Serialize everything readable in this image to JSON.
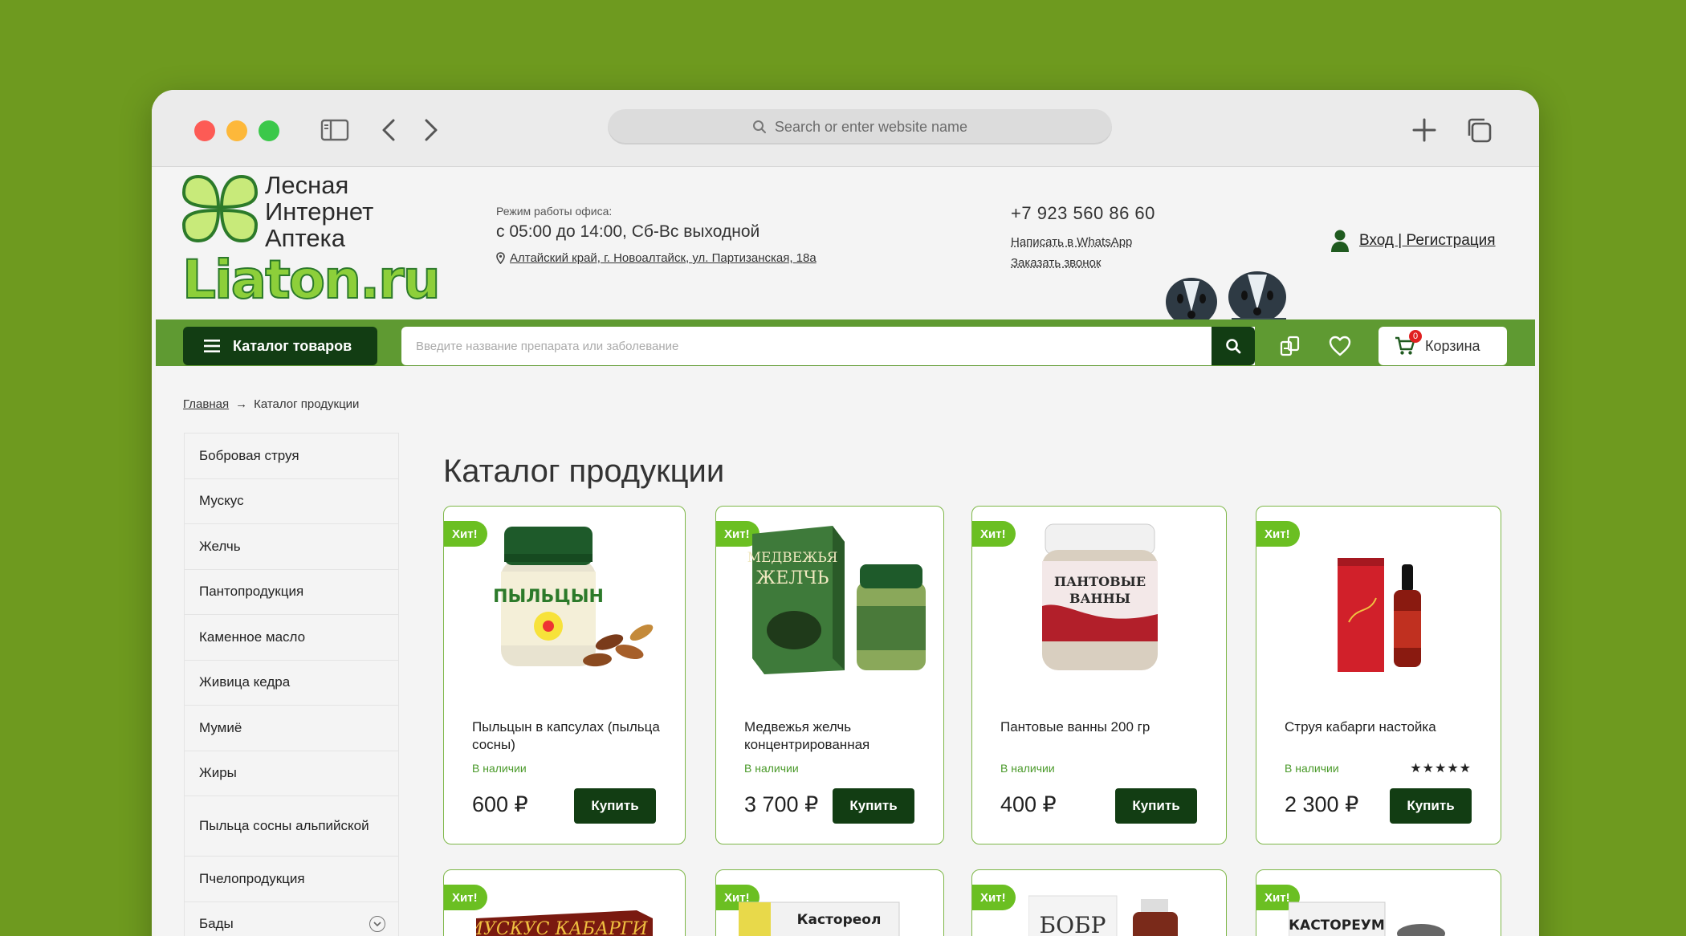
{
  "browser": {
    "url_placeholder": "Search or enter website name"
  },
  "logo": {
    "line1": "Лесная",
    "line2": "Интернет",
    "line3": "Аптека",
    "brand": "Liaton.ru"
  },
  "office": {
    "label": "Режим работы офиса:",
    "hours": "с 05:00 до 14:00, Сб-Вс выходной",
    "address": "Алтайский край, г. Новоалтайск, ул. Партизанская, 18а"
  },
  "contacts": {
    "phone": "+7 923 560 86 60",
    "whatsapp": "Написать в WhatsApp",
    "callback": "Заказать звонок"
  },
  "login": {
    "label": "Вход | Регистрация"
  },
  "nav": {
    "catalog_label": "Каталог товаров",
    "search_placeholder": "Введите название препарата или заболевание",
    "cart_label": "Корзина",
    "cart_count": "0"
  },
  "breadcrumb": {
    "home": "Главная",
    "sep": "→",
    "current": "Каталог продукции"
  },
  "sidemenu": [
    {
      "label": "Бобровая струя"
    },
    {
      "label": "Мускус"
    },
    {
      "label": "Желчь"
    },
    {
      "label": "Пантопродукция"
    },
    {
      "label": "Каменное масло"
    },
    {
      "label": "Живица кедра"
    },
    {
      "label": "Мумиё"
    },
    {
      "label": "Жиры"
    },
    {
      "label": "Пыльца сосны альпийской"
    },
    {
      "label": "Пчелопродукция"
    },
    {
      "label": "Бады"
    }
  ],
  "page_title": "Каталог продукции",
  "products": [
    {
      "badge": "Хит!",
      "name": "Пыльцын в капсулах (пыльца сосны)",
      "stock": "В наличии",
      "price": "600 ₽",
      "buy": "Купить"
    },
    {
      "badge": "Хит!",
      "name": "Медвежья желчь концентрированная",
      "stock": "В наличии",
      "price": "3 700 ₽",
      "buy": "Купить"
    },
    {
      "badge": "Хит!",
      "name": "Пантовые ванны 200 гр",
      "stock": "В наличии",
      "price": "400 ₽",
      "buy": "Купить"
    },
    {
      "badge": "Хит!",
      "name": "Струя кабарги настойка",
      "stock": "В наличии",
      "price": "2 300 ₽",
      "buy": "Купить",
      "rating": 5
    }
  ],
  "products_row2": [
    {
      "badge": "Хит!"
    },
    {
      "badge": "Хит!"
    },
    {
      "badge": "Хит!"
    },
    {
      "badge": "Хит!"
    }
  ],
  "colors": {
    "brand_green": "#5f9a32",
    "dark_green": "#123d13",
    "badge_green": "#6bbf22"
  }
}
